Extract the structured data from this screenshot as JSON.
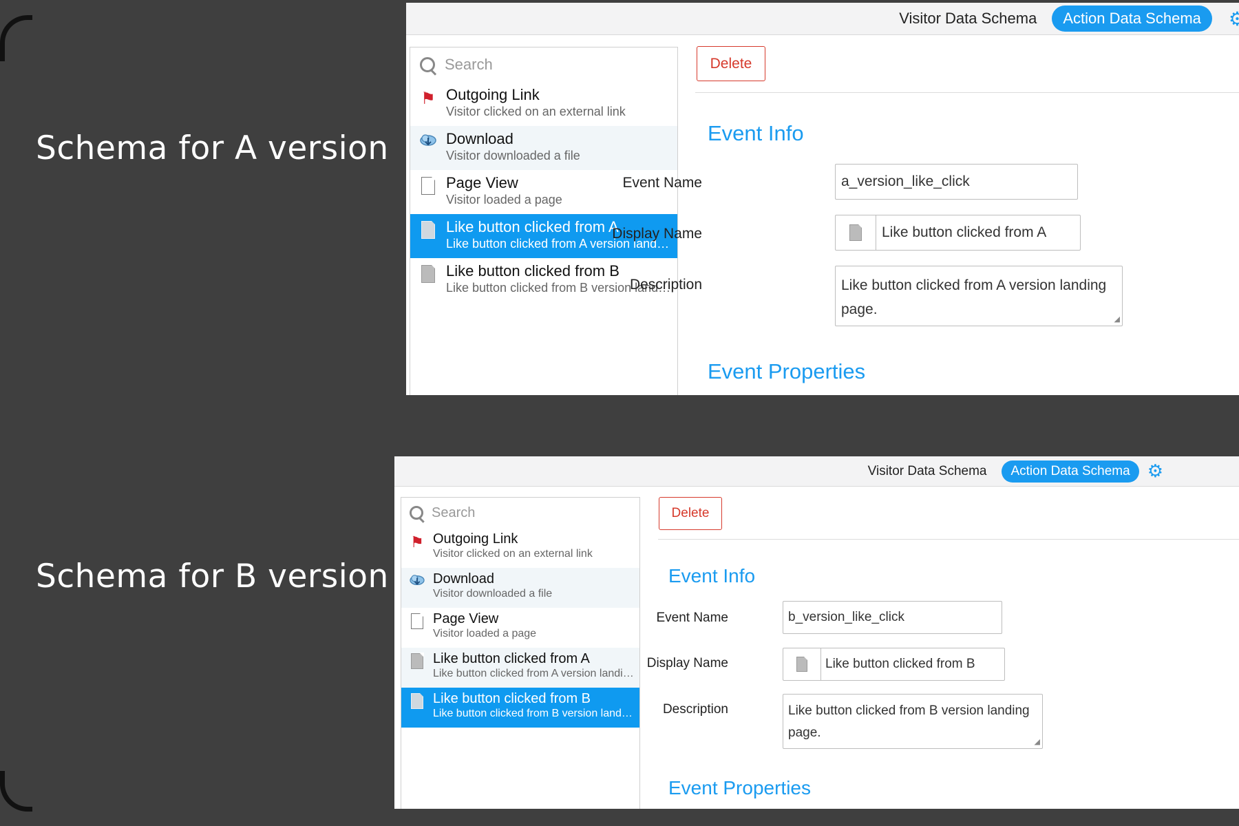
{
  "slide": {
    "label_a": "Schema for A version",
    "label_b": "Schema for B version"
  },
  "screen_a": {
    "topbar": {
      "visitor_tab": "Visitor Data Schema",
      "action_tab": "Action Data Schema",
      "settings_icon": "gear-icon"
    },
    "search_placeholder": "Search",
    "items": [
      {
        "title": "Outgoing Link",
        "subtitle": "Visitor clicked on an external link",
        "icon": "flag-icon"
      },
      {
        "title": "Download",
        "subtitle": "Visitor downloaded a file",
        "icon": "cloud-download-icon"
      },
      {
        "title": "Page View",
        "subtitle": "Visitor loaded a page",
        "icon": "page-icon"
      },
      {
        "title": "Like button clicked from A",
        "subtitle": "Like button clicked from A version landing page.",
        "icon": "document-icon",
        "selected": true
      },
      {
        "title": "Like button clicked from B",
        "subtitle": "Like button clicked from B version landing page.",
        "icon": "document-icon"
      }
    ],
    "delete_label": "Delete",
    "event_info_heading": "Event Info",
    "event_name_label": "Event Name",
    "event_name_value": "a_version_like_click",
    "display_name_label": "Display Name",
    "display_name_value": "Like button clicked from A",
    "description_label": "Description",
    "description_value": "Like button clicked from A version landing page.",
    "event_properties_heading": "Event Properties"
  },
  "screen_b": {
    "topbar": {
      "visitor_tab": "Visitor Data Schema",
      "action_tab": "Action Data Schema",
      "settings_icon": "gear-icon"
    },
    "search_placeholder": "Search",
    "items": [
      {
        "title": "Outgoing Link",
        "subtitle": "Visitor clicked on an external link",
        "icon": "flag-icon"
      },
      {
        "title": "Download",
        "subtitle": "Visitor downloaded a file",
        "icon": "cloud-download-icon"
      },
      {
        "title": "Page View",
        "subtitle": "Visitor loaded a page",
        "icon": "page-icon"
      },
      {
        "title": "Like button clicked from A",
        "subtitle": "Like button clicked from A version landing page.",
        "icon": "document-icon"
      },
      {
        "title": "Like button clicked from B",
        "subtitle": "Like button clicked from B version landing page.",
        "icon": "document-icon",
        "selected": true
      }
    ],
    "delete_label": "Delete",
    "event_info_heading": "Event Info",
    "event_name_label": "Event Name",
    "event_name_value": "b_version_like_click",
    "display_name_label": "Display Name",
    "display_name_value": "Like button clicked from B",
    "description_label": "Description",
    "description_value": "Like button clicked from B version landing page.",
    "event_properties_heading": "Event Properties"
  },
  "colors": {
    "background": "#3f3f3f",
    "accent": "#1a9bf0",
    "selected_row": "#0f9af0",
    "delete": "#d6392b"
  }
}
